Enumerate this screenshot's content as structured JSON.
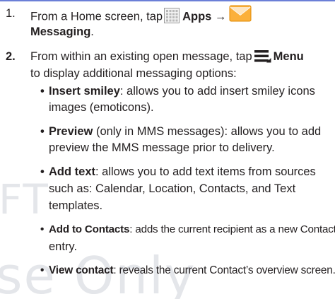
{
  "watermark": {
    "line1": "FT",
    "line2": "se Only"
  },
  "step1": {
    "number": "1.",
    "text_pre": "From a Home screen, tap",
    "apps_label": "Apps",
    "arrow": "→",
    "messaging_label": "Messaging",
    "period": "."
  },
  "step2": {
    "number": "2.",
    "text_pre": "From within an existing open message, tap",
    "menu_label": "Menu",
    "text_post": "to display additional messaging options:"
  },
  "bullets": [
    {
      "term": "Insert smiley",
      "line1": ": allows you to add insert smiley icons",
      "line2": "images (emoticons)."
    },
    {
      "term": "Preview",
      "line1": " (only in MMS messages): allows you to add",
      "line2": "preview the MMS message prior to delivery."
    },
    {
      "term": "Add text",
      "line1": ": allows you to add text items from sources",
      "line2": "such as: Calendar, Location, Contacts, and Text",
      "line3": "templates."
    },
    {
      "term": "Add to Contacts",
      "line1": ": adds the current recipient as a new Contacts",
      "line2": "entry."
    },
    {
      "term": "View contact",
      "line1": ": reveals the current Contact’s overview screen."
    }
  ],
  "bullet_char": "•",
  "colors": {
    "text": "#231f20",
    "rule": "#6b7fd7",
    "watermark": "#e4e6ea",
    "envelope": "#f7a31f"
  },
  "icons": [
    "apps-grid-icon",
    "messaging-envelope-icon",
    "menu-icon"
  ]
}
